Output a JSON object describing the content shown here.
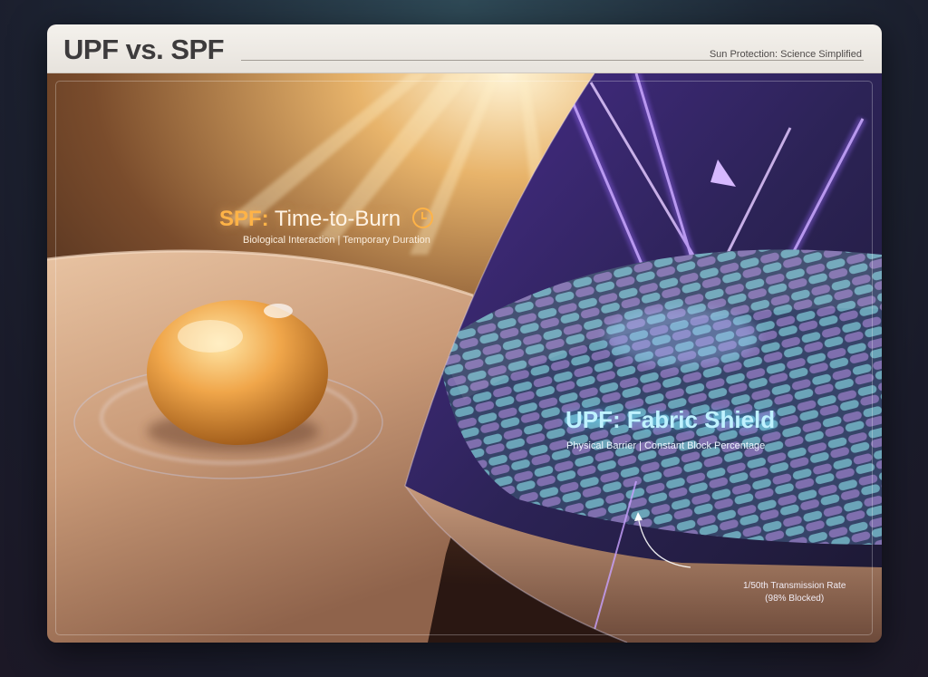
{
  "header": {
    "title": "UPF vs. SPF",
    "subtitle": "Sun Protection: Science Simplified"
  },
  "spf": {
    "label_prefix": "SPF:",
    "label_text": "Time-to-Burn",
    "icon": "clock-icon",
    "subtitle": "Biological Interaction | Temporary Duration",
    "accent": "#ffb347"
  },
  "upf": {
    "label": "UPF: Fabric Shield",
    "subtitle": "Physical Barrier | Constant Block Percentage",
    "accent": "#bff2ff",
    "annotation": {
      "line1": "1/50th Transmission Rate",
      "line2": "(98% Blocked)"
    }
  }
}
